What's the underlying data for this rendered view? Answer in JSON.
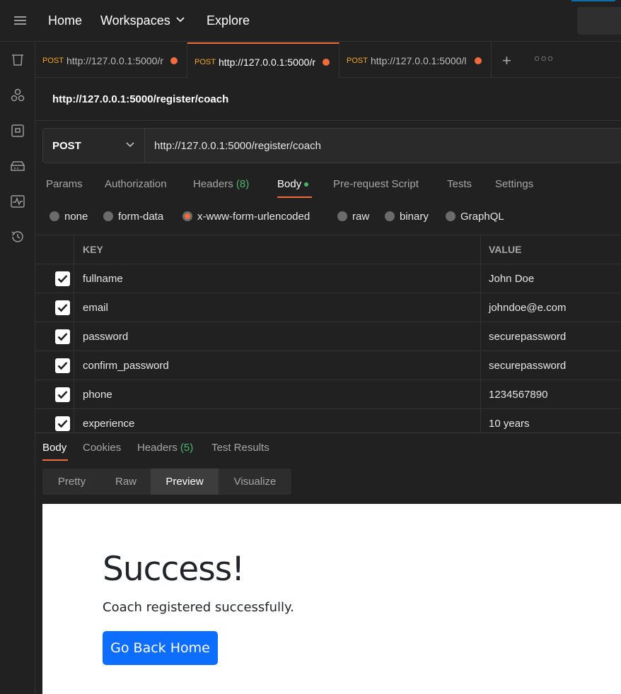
{
  "topbar": {
    "nav": [
      "Home",
      "Workspaces",
      "Explore"
    ]
  },
  "sidebar": {
    "icons": [
      "collections-icon",
      "apis-icon",
      "environments-icon",
      "mock-servers-icon",
      "monitors-icon",
      "history-icon"
    ]
  },
  "tabs": [
    {
      "method": "POST",
      "url": "http://127.0.0.1:5000/r"
    },
    {
      "method": "POST",
      "url": "http://127.0.0.1:5000/r"
    },
    {
      "method": "POST",
      "url": "http://127.0.0.1:5000/l"
    }
  ],
  "request": {
    "title": "http://127.0.0.1:5000/register/coach",
    "method": "POST",
    "url": "http://127.0.0.1:5000/register/coach",
    "tabs": {
      "params": "Params",
      "authorization": "Authorization",
      "headers": "Headers",
      "headers_count": "(8)",
      "body": "Body",
      "prerequest": "Pre-request Script",
      "tests": "Tests",
      "settings": "Settings"
    },
    "body_types": [
      "none",
      "form-data",
      "x-www-form-urlencoded",
      "raw",
      "binary",
      "GraphQL"
    ],
    "body_type_selected": "x-www-form-urlencoded",
    "table": {
      "key_header": "KEY",
      "value_header": "VALUE",
      "rows": [
        {
          "key": "fullname",
          "value": "John Doe"
        },
        {
          "key": "email",
          "value": "johndoe@e.com"
        },
        {
          "key": "password",
          "value": "securepassword"
        },
        {
          "key": "confirm_password",
          "value": "securepassword"
        },
        {
          "key": "phone",
          "value": "1234567890"
        },
        {
          "key": "experience",
          "value": "10 years"
        }
      ]
    }
  },
  "response": {
    "tabs": {
      "body": "Body",
      "cookies": "Cookies",
      "headers": "Headers",
      "headers_count": "(5)",
      "test_results": "Test Results"
    },
    "views": [
      "Pretty",
      "Raw",
      "Preview",
      "Visualize"
    ],
    "view_selected": "Preview",
    "preview": {
      "heading": "Success!",
      "message": "Coach registered successfully.",
      "button": "Go Back Home"
    }
  },
  "colors": {
    "accent": "#f26b3a",
    "method": "#f5a623",
    "count": "#49b56d",
    "primary_button": "#0d6efd"
  }
}
